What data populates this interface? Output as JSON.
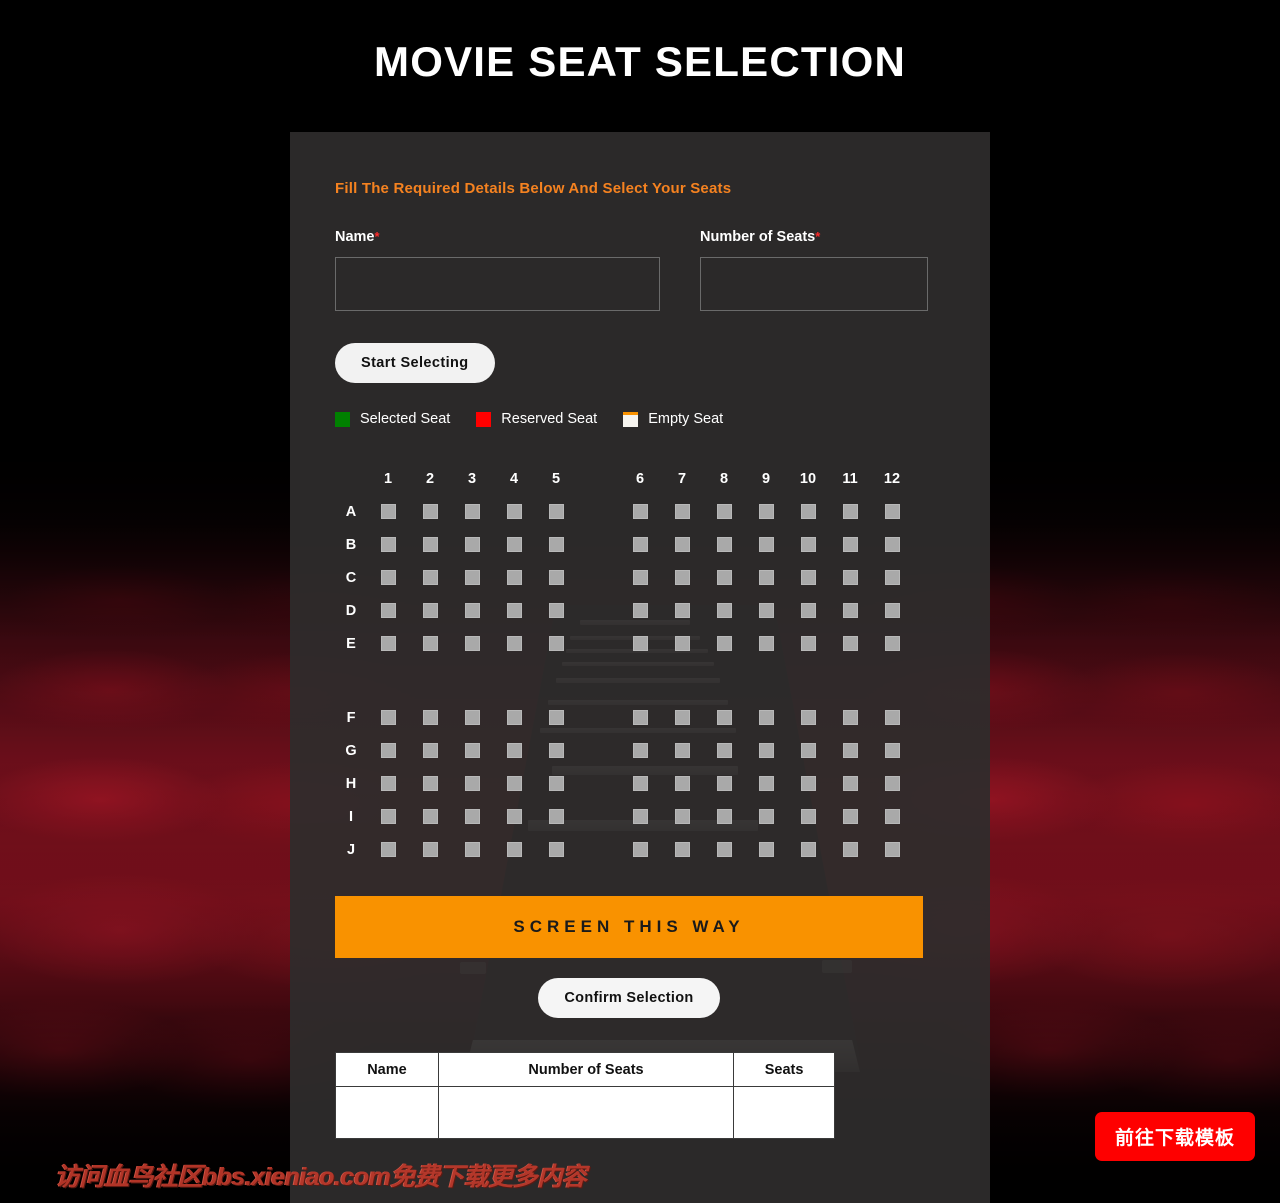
{
  "page": {
    "title": "MOVIE SEAT SELECTION"
  },
  "form": {
    "heading": "Fill The Required Details Below And Select Your Seats",
    "required_marker": "*",
    "name": {
      "label": "Name",
      "value": "",
      "placeholder": ""
    },
    "number_of_seats": {
      "label": "Number of Seats",
      "value": "",
      "placeholder": ""
    },
    "start_button": "Start Selecting"
  },
  "legend": {
    "items": [
      {
        "label": "Selected Seat",
        "color": "#008000",
        "icon": "green-square-icon"
      },
      {
        "label": "Reserved Seat",
        "color": "#ff0000",
        "icon": "red-square-icon"
      },
      {
        "label": "Empty Seat",
        "color": "#f3f0ea",
        "icon": "empty-seat-icon"
      }
    ]
  },
  "seat_map": {
    "columns": [
      "1",
      "2",
      "3",
      "4",
      "5",
      "6",
      "7",
      "8",
      "9",
      "10",
      "11",
      "12"
    ],
    "aisle_after_column": "5",
    "rows": [
      "A",
      "B",
      "C",
      "D",
      "E",
      "F",
      "G",
      "H",
      "I",
      "J"
    ],
    "aisle_after_row": "E",
    "seat_state": "empty",
    "seat_color": "#a9a9a9"
  },
  "screen": {
    "banner_text": "SCREEN THIS WAY",
    "banner_color": "#f99200"
  },
  "confirm": {
    "label": "Confirm Selection"
  },
  "result_table": {
    "headers": [
      "Name",
      "Number of Seats",
      "Seats"
    ],
    "rows": [
      [
        "",
        "",
        ""
      ]
    ]
  },
  "overlay": {
    "watermark": "访问血鸟社区bbs.xieniao.com免费下载更多内容",
    "download_button": "前往下载模板"
  }
}
